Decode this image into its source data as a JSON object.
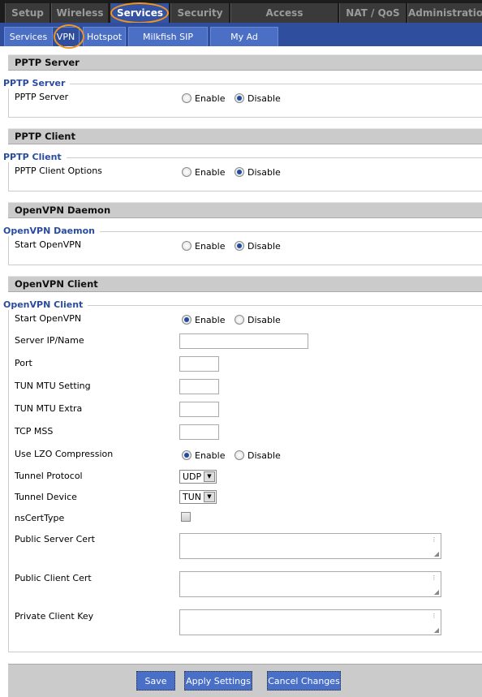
{
  "top_tabs": [
    "Setup",
    "Wireless",
    "Services",
    "Security",
    "Access Restrictions",
    "NAT / QoS",
    "Administration"
  ],
  "active_top_tab": "Services",
  "sub_tabs": [
    "Services",
    "VPN",
    "Hotspot",
    "Milkfish SIP Router",
    "My Ad Network"
  ],
  "active_sub_tab": "VPN",
  "pptp_server": {
    "header": "PPTP Server",
    "legend": "PPTP Server",
    "label": "PPTP Server",
    "value": "Disable"
  },
  "pptp_client": {
    "header": "PPTP Client",
    "legend": "PPTP Client",
    "label": "PPTP Client Options",
    "value": "Disable"
  },
  "openvpn_daemon": {
    "header": "OpenVPN Daemon",
    "legend": "OpenVPN Daemon",
    "label": "Start OpenVPN",
    "value": "Disable"
  },
  "openvpn_client": {
    "header": "OpenVPN Client",
    "legend": "OpenVPN Client",
    "start_label": "Start OpenVPN",
    "start_value": "Enable",
    "server_label": "Server IP/Name",
    "server_value": "",
    "port_label": "Port",
    "mtu_label": "TUN MTU Setting",
    "mtu_extra_label": "TUN MTU Extra",
    "mss_label": "TCP MSS",
    "lzo_label": "Use LZO Compression",
    "lzo_value": "Enable",
    "protocol_label": "Tunnel Protocol",
    "protocol_value": "UDP",
    "device_label": "Tunnel Device",
    "device_value": "TUN",
    "nscert_label": "nsCertType",
    "nscert_checked": false,
    "server_cert_label": "Public Server Cert",
    "client_cert_label": "Public Client Cert",
    "client_key_label": "Private Client Key"
  },
  "radio_labels": {
    "enable": "Enable",
    "disable": "Disable"
  },
  "buttons": {
    "save": "Save",
    "apply": "Apply Settings",
    "cancel": "Cancel Changes"
  },
  "colors": {
    "accent": "#2f4e9e",
    "highlight_ring": "#f0951c"
  }
}
